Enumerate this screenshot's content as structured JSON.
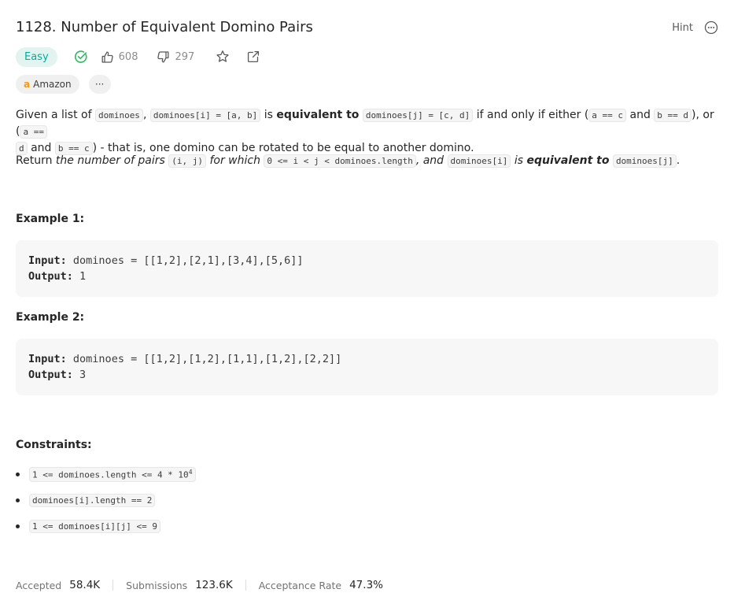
{
  "problem": {
    "title": "1128. Number of Equivalent Domino Pairs",
    "hint_label": "Hint",
    "difficulty": "Easy",
    "likes": "608",
    "dislikes": "297",
    "company_tag": "Amazon",
    "more_tags": "···"
  },
  "description": {
    "p1": {
      "t1": "Given a list of ",
      "c1": "dominoes",
      "t2": ", ",
      "c2": "dominoes[i] = [a, b]",
      "t3": " is ",
      "b1": "equivalent to",
      "t4": " ",
      "c3": "dominoes[j] = [c, d]",
      "t5": " if and only if either (",
      "c4": "a == c",
      "t6": " and ",
      "c5": "b == d",
      "t7": "), or (",
      "c6a": "a ==",
      "c6b": "d",
      "t8": " and ",
      "c7": "b == c",
      "t9": ") - that is, one domino can be rotated to be equal to another domino."
    },
    "p2": {
      "t1": "Return ",
      "i1": "the number of pairs",
      "c1": "(i, j)",
      "i2": "for which",
      "c2": "0 <= i < j < dominoes.length",
      "i3": ", and",
      "c3": "dominoes[i]",
      "i4": "is",
      "bi1": "equivalent to",
      "c4": "dominoes[j]",
      "t2": "."
    }
  },
  "examples": [
    {
      "heading": "Example 1:",
      "input_label": "Input:",
      "input": "dominoes = [[1,2],[2,1],[3,4],[5,6]]",
      "output_label": "Output:",
      "output": "1"
    },
    {
      "heading": "Example 2:",
      "input_label": "Input:",
      "input": "dominoes = [[1,2],[1,2],[1,1],[1,2],[2,2]]",
      "output_label": "Output:",
      "output": "3"
    }
  ],
  "constraints": {
    "heading": "Constraints:",
    "items": [
      {
        "text": "1 <= dominoes.length <= 4 * 10",
        "sup": "4"
      },
      {
        "text": "dominoes[i].length == 2",
        "sup": ""
      },
      {
        "text": "1 <= dominoes[i][j] <= 9",
        "sup": ""
      }
    ]
  },
  "stats": {
    "accepted_label": "Accepted",
    "accepted_value": "58.4K",
    "submissions_label": "Submissions",
    "submissions_value": "123.6K",
    "rate_label": "Acceptance Rate",
    "rate_value": "47.3%"
  },
  "colors": {
    "easy": "#00af9b",
    "easy_bg": "#e2f3f0",
    "solved_check": "#2cbb5d",
    "amazon": "#ff9900"
  },
  "icons": {
    "solved": "check-circle-icon",
    "like": "thumbs-up-icon",
    "dislike": "thumbs-down-icon",
    "favorite": "star-icon",
    "share": "share-icon",
    "more": "more-circle-icon"
  }
}
